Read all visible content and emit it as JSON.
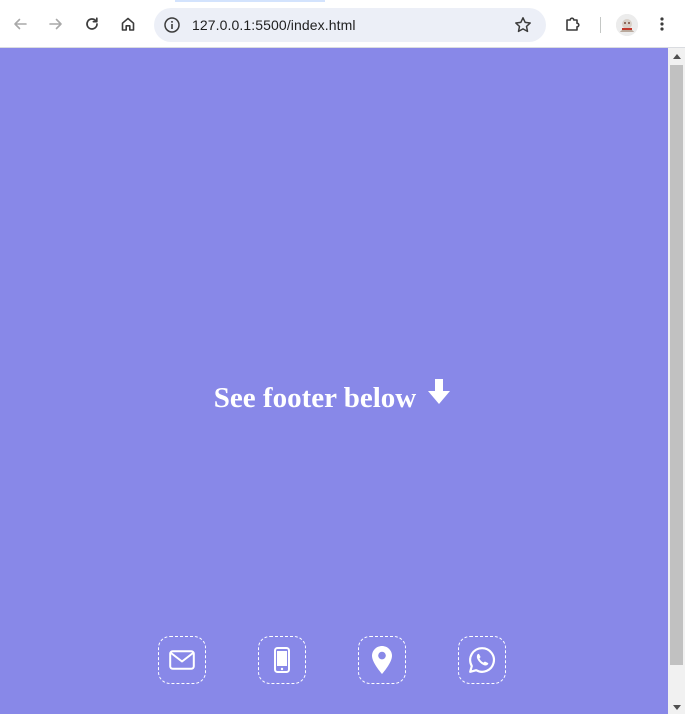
{
  "browser": {
    "url": "127.0.0.1:5500/index.html",
    "icons": {
      "back": "arrow-left-icon",
      "forward": "arrow-right-icon",
      "reload": "reload-icon",
      "home": "home-icon",
      "site_info": "info-icon",
      "bookmark": "star-icon",
      "extensions": "puzzle-icon",
      "profile": "avatar",
      "menu": "kebab-menu-icon"
    }
  },
  "page": {
    "background_color": "#8888e8",
    "headline": "See footer below",
    "headline_icon": "arrow-down-icon"
  },
  "footer": {
    "icons": [
      {
        "name": "envelope-icon"
      },
      {
        "name": "mobile-phone-icon"
      },
      {
        "name": "map-marker-icon"
      },
      {
        "name": "whatsapp-icon"
      }
    ]
  }
}
